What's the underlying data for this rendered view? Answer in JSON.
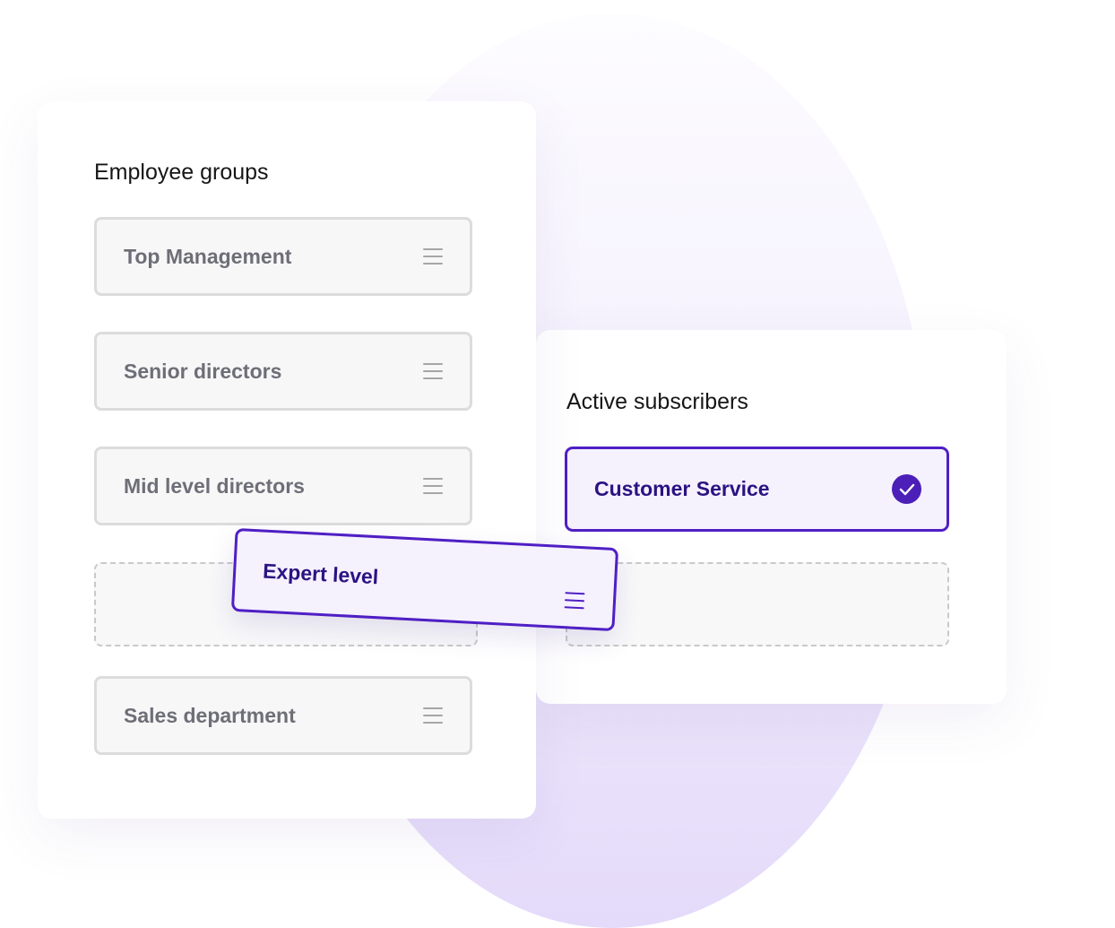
{
  "employee_groups": {
    "title": "Employee groups",
    "items": [
      {
        "label": "Top Management"
      },
      {
        "label": "Senior directors"
      },
      {
        "label": "Mid level directors"
      },
      {
        "label": "Sales department"
      }
    ]
  },
  "active_subscribers": {
    "title": "Active subscribers",
    "items": [
      {
        "label": "Customer Service",
        "selected": true
      }
    ]
  },
  "dragged_item": {
    "label": "Expert level"
  },
  "colors": {
    "accent": "#4f1fc4",
    "accent_text": "#2a1382",
    "item_border": "#dcdcdc",
    "item_text": "#6e6e78"
  }
}
